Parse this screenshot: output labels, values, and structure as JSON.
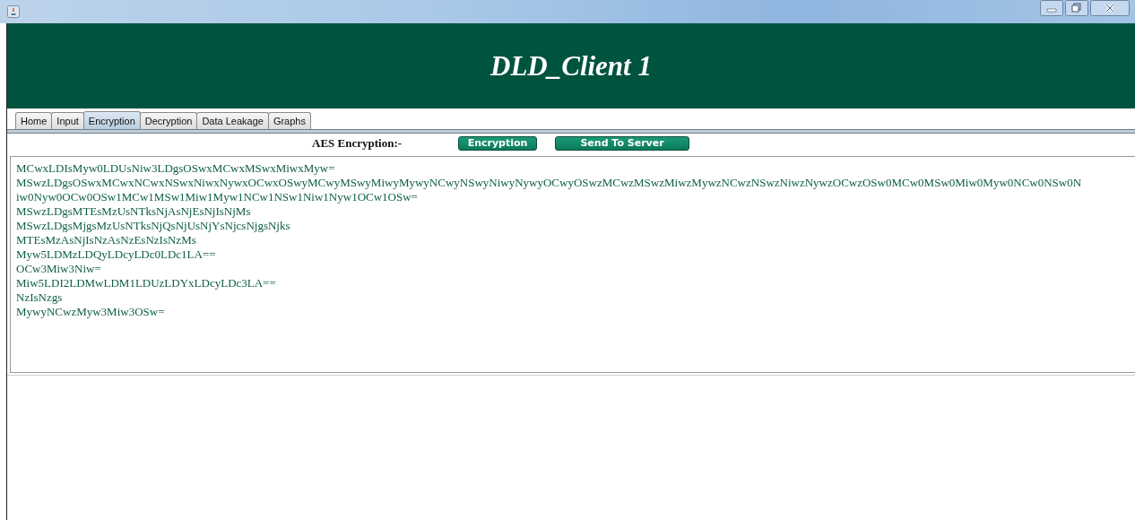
{
  "header": {
    "title": "DLD_Client 1"
  },
  "tabs": [
    {
      "label": "Home",
      "selected": false
    },
    {
      "label": "Input",
      "selected": false
    },
    {
      "label": "Encryption",
      "selected": true
    },
    {
      "label": "Decryption",
      "selected": false
    },
    {
      "label": "Data Leakage",
      "selected": false
    },
    {
      "label": "Graphs",
      "selected": false
    }
  ],
  "toolbar": {
    "label": "AES Encryption:-",
    "buttons": [
      "Encryption",
      "Send To Server"
    ]
  },
  "output_lines": [
    "MCwxLDIsMyw0LDUsNiw3LDgsOSwxMCwxMSwxMiwxMyw=",
    "MSwzLDgsOSwxMCwxNCwxNSwxNiwxNywxOCwxOSwyMCwyMSwyMiwyMywyNCwyNSwyNiwyNywyOCwyOSwzMCwzMSwzMiwzMywzNCwzNSwzNiwzNywzOCwzOSw0MCw0MSw0Miw0Myw0NCw0NSw0N",
    "iw0Nyw0OCw0OSw1MCw1MSw1Miw1Myw1NCw1NSw1Niw1Nyw1OCw1OSw=",
    "MSwzLDgsMTEsMzUsNTksNjAsNjEsNjIsNjMs",
    "MSwzLDgsMjgsMzUsNTksNjQsNjUsNjYsNjcsNjgsNjks",
    "MTEsMzAsNjIsNzAsNzEsNzIsNzMs",
    "Myw5LDMzLDQyLDcyLDc0LDc1LA==",
    "OCw3Miw3Niw=",
    "Miw5LDI2LDMwLDM1LDUzLDYxLDcyLDc3LA==",
    "NzIsNzgs",
    "MywyNCwzMyw3Miw3OSw="
  ]
}
